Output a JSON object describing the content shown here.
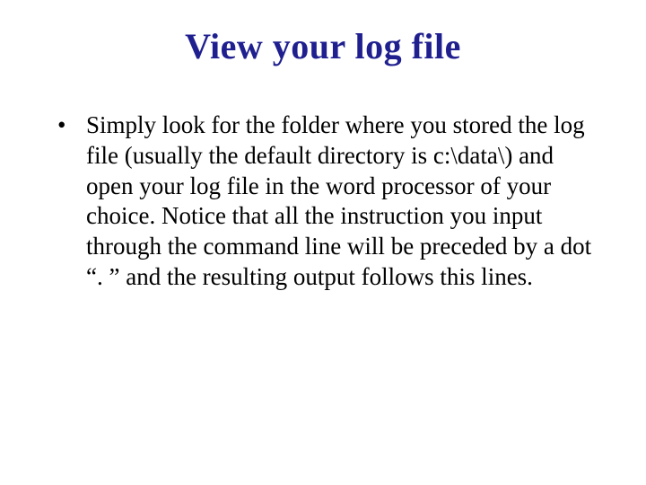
{
  "slide": {
    "title": "View your log file",
    "bullets": [
      "Simply look for the folder where you stored the log file (usually the default directory is c:\\data\\) and open your log file in the word processor of your choice. Notice that all the instruction you input through the command line will be preceded by a dot “. ” and the resulting output follows this lines."
    ]
  }
}
